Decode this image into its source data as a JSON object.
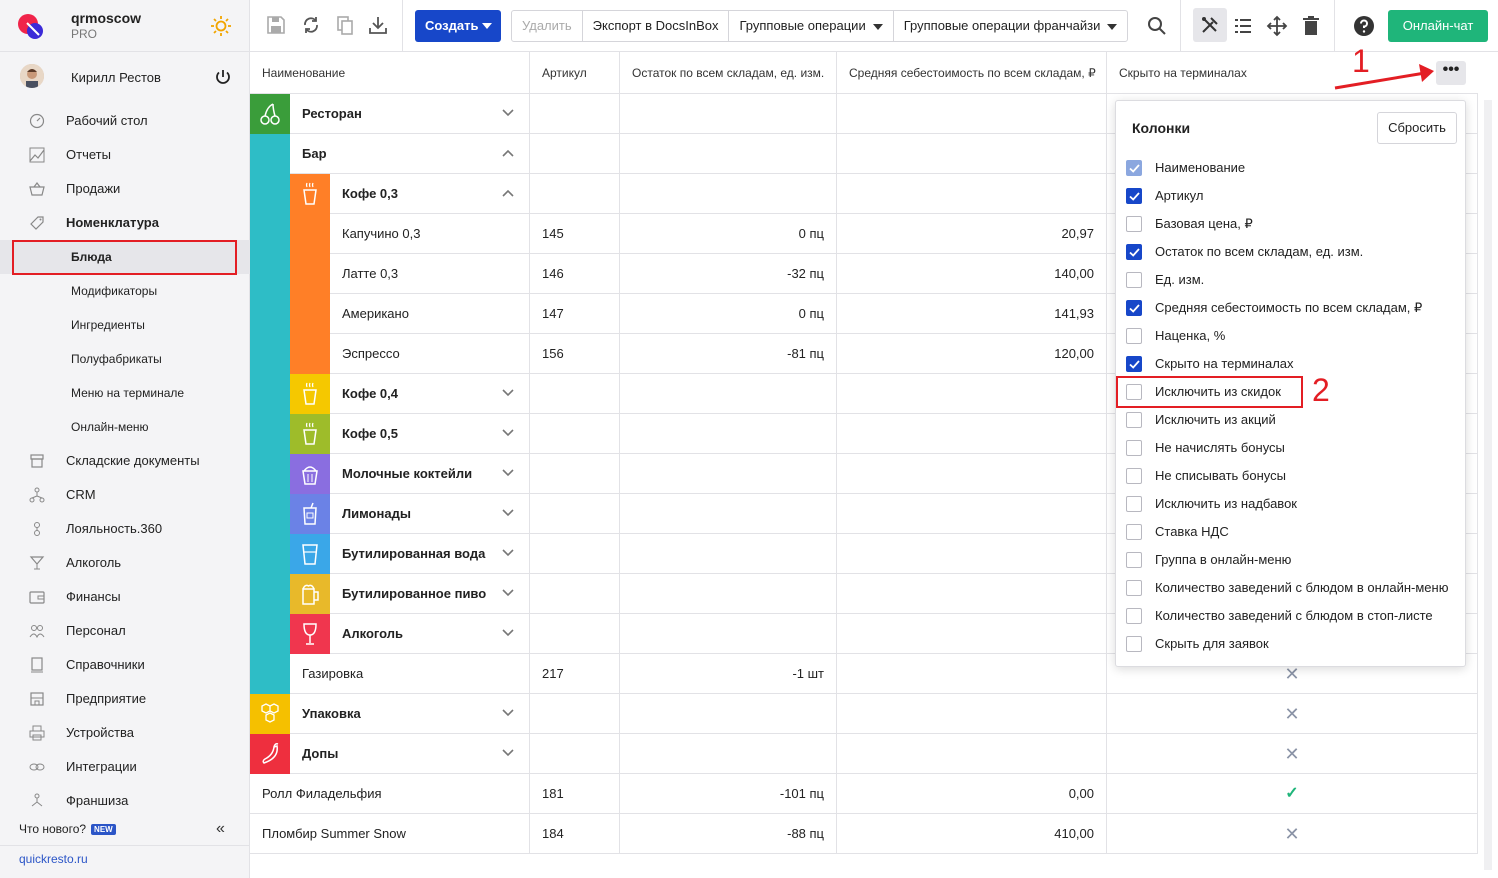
{
  "brand": {
    "name": "qrmoscow",
    "plan": "PRO"
  },
  "user": {
    "name": "Кирилл Рестов"
  },
  "sidebar": {
    "items": [
      {
        "label": "Рабочий стол",
        "icon": "dashboard-icon"
      },
      {
        "label": "Отчеты",
        "icon": "reports-icon"
      },
      {
        "label": "Продажи",
        "icon": "basket-icon"
      },
      {
        "label": "Номенклатура",
        "icon": "tag-icon"
      },
      {
        "label": "Блюда"
      },
      {
        "label": "Модификаторы"
      },
      {
        "label": "Ингредиенты"
      },
      {
        "label": "Полуфабрикаты"
      },
      {
        "label": "Меню на терминале"
      },
      {
        "label": "Онлайн-меню"
      },
      {
        "label": "Складские документы",
        "icon": "warehouse-icon"
      },
      {
        "label": "CRM",
        "icon": "crm-icon"
      },
      {
        "label": "Лояльность.360",
        "icon": "loyalty-icon"
      },
      {
        "label": "Алкоголь",
        "icon": "wine-glass-icon"
      },
      {
        "label": "Финансы",
        "icon": "wallet-icon"
      },
      {
        "label": "Персонал",
        "icon": "people-icon"
      },
      {
        "label": "Справочники",
        "icon": "book-icon"
      },
      {
        "label": "Предприятие",
        "icon": "building-icon"
      },
      {
        "label": "Устройства",
        "icon": "printer-icon"
      },
      {
        "label": "Интеграции",
        "icon": "link-icon"
      },
      {
        "label": "Франшиза",
        "icon": "franchise-icon"
      }
    ],
    "whats_new": "Что нового?",
    "new_badge": "NEW",
    "site": "quickresto.ru"
  },
  "toolbar": {
    "create": "Создать",
    "delete": "Удалить",
    "export": "Экспорт в DocsInBox",
    "group_ops": "Групповые операции",
    "group_ops_fr": "Групповые операции франчайзи",
    "chat": "Онлайн-чат"
  },
  "table": {
    "headers": {
      "name": "Наименование",
      "article": "Артикул",
      "stock": "Остаток по всем складам, ед. изм.",
      "cost": "Средняя себестоимость по всем складам, ₽",
      "hidden": "Скрыто на терминалах"
    },
    "rows": [
      {
        "name": "Ресторан",
        "type": "group"
      },
      {
        "name": "Бар",
        "type": "group"
      },
      {
        "name": "Кофе 0,3",
        "type": "subgroup"
      },
      {
        "name": "Капучино 0,3",
        "article": "145",
        "stock": "0 пц",
        "cost": "20,97"
      },
      {
        "name": "Латте 0,3",
        "article": "146",
        "stock": "-32 пц",
        "cost": "140,00"
      },
      {
        "name": "Американо",
        "article": "147",
        "stock": "0 пц",
        "cost": "141,93"
      },
      {
        "name": "Эспрессо",
        "article": "156",
        "stock": "-81 пц",
        "cost": "120,00"
      },
      {
        "name": "Кофе 0,4",
        "type": "subgroup"
      },
      {
        "name": "Кофе 0,5",
        "type": "subgroup"
      },
      {
        "name": "Молочные коктейли",
        "type": "subgroup"
      },
      {
        "name": "Лимонады",
        "type": "subgroup"
      },
      {
        "name": "Бутилированная вода",
        "type": "subgroup"
      },
      {
        "name": "Бутилированное пиво",
        "type": "subgroup"
      },
      {
        "name": "Алкоголь",
        "type": "subgroup"
      },
      {
        "name": "Газировка",
        "article": "217",
        "stock": "-1 шт",
        "hidden": "x"
      },
      {
        "name": "Упаковка",
        "type": "group",
        "hidden": "x"
      },
      {
        "name": "Допы",
        "type": "group",
        "hidden": "x"
      },
      {
        "name": "Ролл Филадельфия",
        "article": "181",
        "stock": "-101 пц",
        "cost": "0,00",
        "hidden": "check"
      },
      {
        "name": "Пломбир Summer Snow",
        "article": "184",
        "stock": "-88 пц",
        "cost": "410,00",
        "hidden": "x"
      }
    ]
  },
  "columns_popup": {
    "title": "Колонки",
    "reset": "Сбросить",
    "options": [
      {
        "label": "Наименование",
        "checked": true,
        "disabled": true
      },
      {
        "label": "Артикул",
        "checked": true
      },
      {
        "label": "Базовая цена, ₽",
        "checked": false
      },
      {
        "label": "Остаток по всем складам, ед. изм.",
        "checked": true
      },
      {
        "label": "Ед. изм.",
        "checked": false
      },
      {
        "label": "Средняя себестоимость по всем складам, ₽",
        "checked": true
      },
      {
        "label": "Наценка, %",
        "checked": false
      },
      {
        "label": "Скрыто на терминалах",
        "checked": true
      },
      {
        "label": "Исключить из скидок",
        "checked": false
      },
      {
        "label": "Исключить из акций",
        "checked": false
      },
      {
        "label": "Не начислять бонусы",
        "checked": false
      },
      {
        "label": "Не списывать бонусы",
        "checked": false
      },
      {
        "label": "Исключить из надбавок",
        "checked": false
      },
      {
        "label": "Ставка НДС",
        "checked": false
      },
      {
        "label": "Группа в онлайн-меню",
        "checked": false
      },
      {
        "label": "Количество заведений с блюдом в онлайн-меню",
        "checked": false
      },
      {
        "label": "Количество заведений с блюдом в стоп-листе",
        "checked": false
      },
      {
        "label": "Скрыть для заявок",
        "checked": false
      }
    ]
  },
  "annotations": {
    "one": "1",
    "two": "2"
  },
  "colors": {
    "accent": "#1747c9",
    "chat": "#1fb57a",
    "annotation": "#e31e24",
    "restaurant": "#3a9d3a",
    "bar": "#2ebdc6",
    "coffee03": "#ff7f27",
    "coffee04": "#f5c800",
    "coffee05": "#9ebc2a",
    "shakes": "#8a6ee0",
    "lemonade": "#6b82e6",
    "water": "#3aa7e8",
    "beer": "#e8b92a",
    "alcohol": "#f0364e",
    "packaging": "#f5c000",
    "extras": "#ee2f3e"
  }
}
